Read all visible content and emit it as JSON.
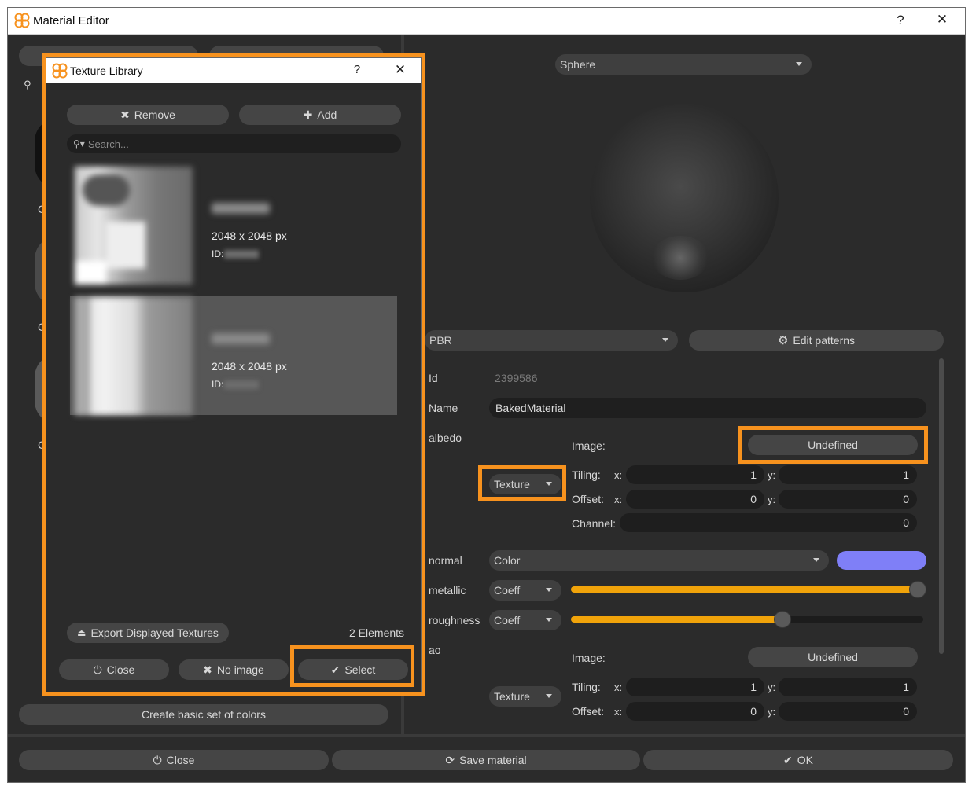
{
  "window": {
    "title": "Material Editor",
    "help": "?",
    "close": "✕"
  },
  "left_panel": {
    "search_glyph": "⚲",
    "partial_labels": [
      "C",
      "C",
      "C",
      "C"
    ],
    "create_basic_colors": "Create basic set of colors"
  },
  "preview": {
    "shape_dropdown": "Sphere"
  },
  "material": {
    "type_dropdown": "PBR",
    "edit_patterns": "Edit patterns",
    "id_label": "Id",
    "id_value": "2399586",
    "name_label": "Name",
    "name_value": "BakedMaterial"
  },
  "albedo": {
    "label": "albedo",
    "image_label": "Image:",
    "image_value": "Undefined",
    "mode": "Texture",
    "tiling_label": "Tiling:",
    "offset_label": "Offset:",
    "channel_label": "Channel:",
    "x_label": "x:",
    "y_label": "y:",
    "tiling_x": "1",
    "tiling_y": "1",
    "offset_x": "0",
    "offset_y": "0",
    "channel": "0"
  },
  "normal": {
    "label": "normal",
    "mode": "Color",
    "swatch_color": "#7f7ff7"
  },
  "metallic": {
    "label": "metallic",
    "mode": "Coeff",
    "level": 1.0
  },
  "roughness": {
    "label": "roughness",
    "mode": "Coeff",
    "level": 0.6
  },
  "ao": {
    "label": "ao",
    "image_label": "Image:",
    "image_value": "Undefined",
    "mode": "Texture",
    "tiling_label": "Tiling:",
    "offset_label": "Offset:",
    "x_label": "x:",
    "y_label": "y:",
    "tiling_x": "1",
    "tiling_y": "1",
    "offset_x": "0",
    "offset_y": "0"
  },
  "footer": {
    "close": "Close",
    "save": "Save material",
    "ok": "OK"
  },
  "texture_library": {
    "title": "Texture Library",
    "help": "?",
    "close_x": "✕",
    "remove": "Remove",
    "add": "Add",
    "search_placeholder": "Search...",
    "items": [
      {
        "size": "2048 x 2048 px",
        "id_label": "ID:"
      },
      {
        "size": "2048 x 2048 px",
        "id_label": "ID:"
      }
    ],
    "export": "Export Displayed Textures",
    "count": "2 Elements",
    "close": "Close",
    "no_image": "No image",
    "select": "Select"
  },
  "colors": {
    "accent": "#f7921e",
    "slider": "#f0a30a",
    "bg": "#2b2b2b"
  }
}
